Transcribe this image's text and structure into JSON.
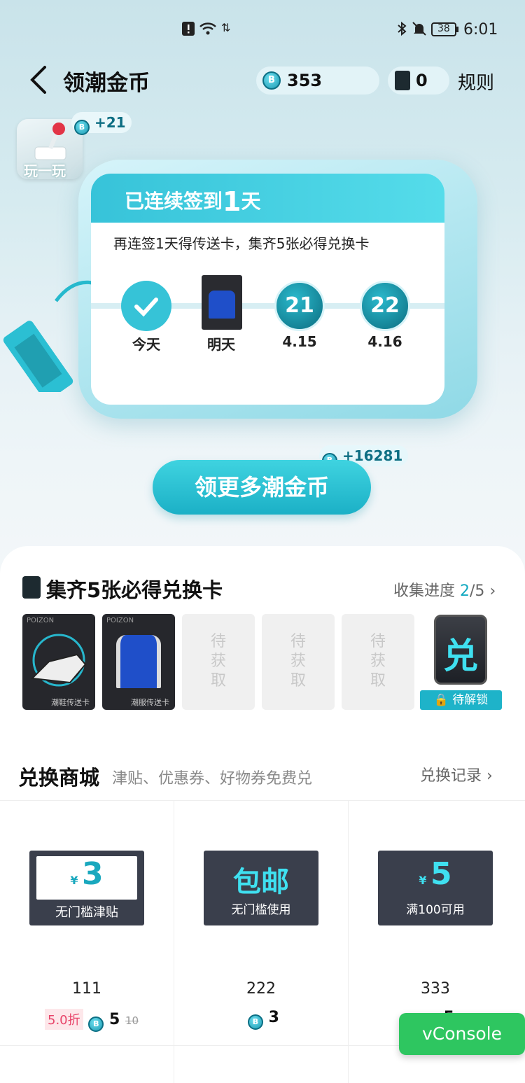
{
  "status_bar": {
    "time": "6:01",
    "battery": "38"
  },
  "header": {
    "title": "领潮金币",
    "coin_balance": "353",
    "card_count": "0",
    "rules_label": "规则"
  },
  "play": {
    "label": "玩一玩",
    "bonus": "+21"
  },
  "checkin": {
    "heading_prefix": "已连续签到",
    "days": "1",
    "heading_suffix": "天",
    "subtitle": "再连签1天得传送卡，集齐5张必得兑换卡",
    "nodes": [
      {
        "label": "今天",
        "kind": "checked"
      },
      {
        "label": "明天",
        "kind": "card"
      },
      {
        "label": "4.15",
        "kind": "coin",
        "value": "21"
      },
      {
        "label": "4.16",
        "kind": "coin",
        "value": "22"
      }
    ]
  },
  "earn_more": {
    "label": "领更多潮金币",
    "bonus": "+16281"
  },
  "collection": {
    "title": "集齐5张必得兑换卡",
    "progress_label": "收集进度",
    "progress_current": "2",
    "progress_total": "/5",
    "cards": [
      {
        "label": "潮鞋传送卡",
        "brand": "POIZON"
      },
      {
        "label": "潮服传送卡",
        "brand": "POIZON"
      }
    ],
    "pending_label": [
      "待",
      "获",
      "取"
    ],
    "reward_char": "兑",
    "unlock_label": "待解锁"
  },
  "mall": {
    "title": "兑换商城",
    "subtitle": "津贴、优惠券、好物券免费兑",
    "records_label": "兑换记录",
    "items": [
      {
        "coupon_symbol": "¥",
        "coupon_main": "3",
        "coupon_caption": "无门槛津贴",
        "name": "111",
        "discount": "5.0折",
        "price": "5",
        "original_price": "10"
      },
      {
        "coupon_main": "包邮",
        "coupon_caption": "无门槛使用",
        "name": "222",
        "price": "3"
      },
      {
        "coupon_symbol": "¥",
        "coupon_main": "5",
        "coupon_caption": "满100可用",
        "name": "333",
        "price": "5"
      }
    ]
  },
  "vconsole_label": "vConsole",
  "colors": {
    "accent": "#1eb3c9",
    "dark": "#3a3f4c",
    "vconsole": "#2ec660"
  }
}
